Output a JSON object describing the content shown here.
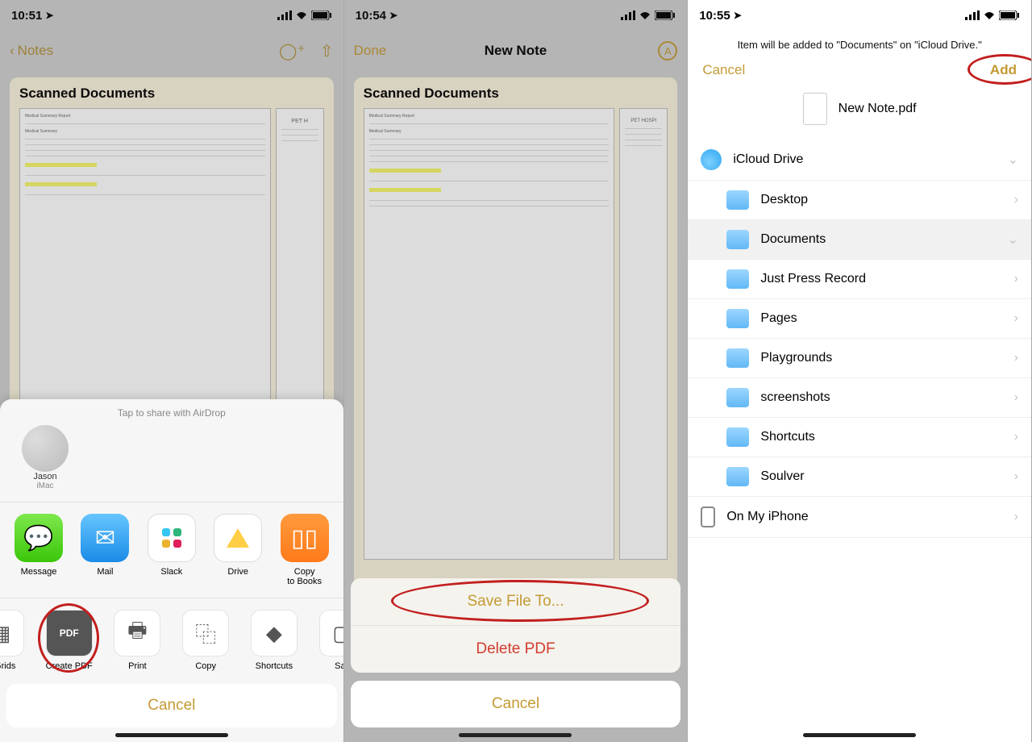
{
  "panel1": {
    "status_time": "10:51",
    "nav_back": "Notes",
    "note_title": "Scanned Documents",
    "share_hint": "Tap to share with AirDrop",
    "airdrop_name": "Jason",
    "airdrop_device": "iMac",
    "apps": {
      "message": "Message",
      "mail": "Mail",
      "slack": "Slack",
      "drive": "Drive",
      "books": "Copy\nto Books"
    },
    "actions": {
      "grids": "& Grids",
      "create_pdf": "Create PDF",
      "print": "Print",
      "copy": "Copy",
      "shortcuts": "Shortcuts",
      "save": "Sav"
    },
    "cancel": "Cancel"
  },
  "panel2": {
    "status_time": "10:54",
    "done": "Done",
    "title": "New Note",
    "note_title": "Scanned Documents",
    "save_to": "Save File To...",
    "delete": "Delete PDF",
    "cancel": "Cancel"
  },
  "panel3": {
    "status_time": "10:55",
    "message": "Item will be added to \"Documents\" on \"iCloud Drive.\"",
    "cancel": "Cancel",
    "add": "Add",
    "file_name": "New Note.pdf",
    "icloud": "iCloud Drive",
    "folders": {
      "desktop": "Desktop",
      "documents": "Documents",
      "jpr": "Just Press Record",
      "pages": "Pages",
      "playgrounds": "Playgrounds",
      "screenshots": "screenshots",
      "shortcuts": "Shortcuts",
      "soulver": "Soulver"
    },
    "on_my_iphone": "On My iPhone"
  }
}
